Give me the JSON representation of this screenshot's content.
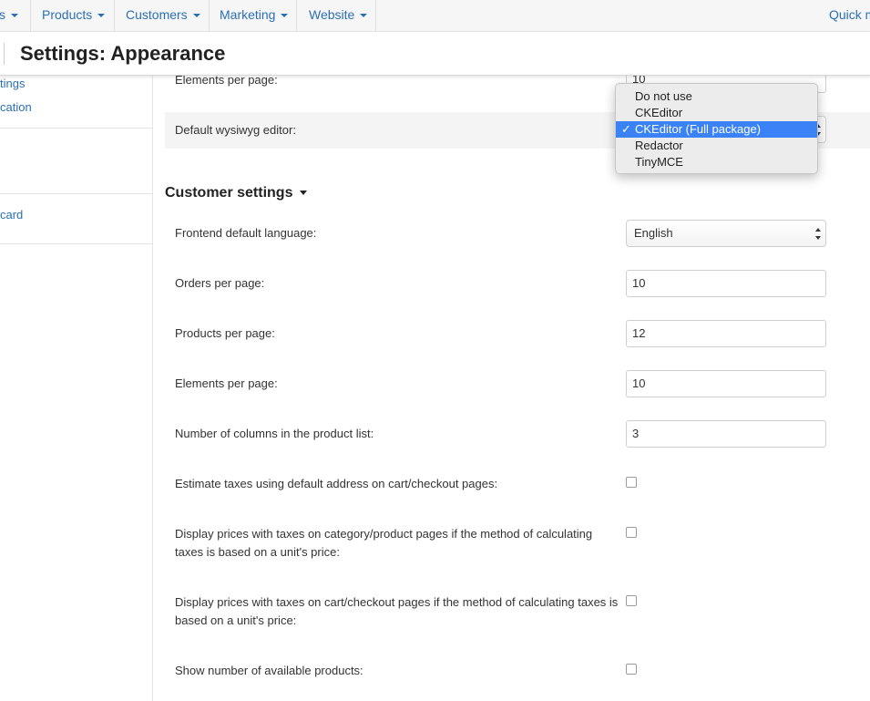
{
  "topnav": {
    "items": [
      {
        "label": "s",
        "caret": true
      },
      {
        "label": "Products",
        "caret": true
      },
      {
        "label": "Customers",
        "caret": true
      },
      {
        "label": "Marketing",
        "caret": true
      },
      {
        "label": "Website",
        "caret": true
      }
    ],
    "quick_menu": "Quick m"
  },
  "header": {
    "title": "Settings: Appearance"
  },
  "sidebar": {
    "links": [
      "tings",
      "cation",
      "card"
    ]
  },
  "appearance": {
    "elements_per_page_label": "Elements per page:",
    "elements_per_page_value": "10",
    "wysiwyg_label": "Default wysiwyg editor:",
    "wysiwyg_options": [
      "Do not use",
      "CKEditor",
      "CKEditor (Full package)",
      "Redactor",
      "TinyMCE"
    ],
    "wysiwyg_selected": "CKEditor (Full package)",
    "check_mark": "✓"
  },
  "customer_settings": {
    "title": "Customer settings",
    "frontend_language_label": "Frontend default language:",
    "frontend_language_value": "English",
    "orders_label": "Orders per page:",
    "orders_value": "10",
    "products_label": "Products per page:",
    "products_value": "12",
    "elements_label": "Elements per page:",
    "elements_value": "10",
    "columns_label": "Number of columns in the product list:",
    "columns_value": "3",
    "estimate_taxes_label": "Estimate taxes using default address on cart/checkout pages:",
    "estimate_taxes_checked": false,
    "display_prices_category_label": "Display prices with taxes on category/product pages if the method of calculating taxes is based on a unit's price:",
    "display_prices_category_checked": false,
    "display_prices_cart_label": "Display prices with taxes on cart/checkout pages if the method of calculating taxes is based on a unit's price:",
    "display_prices_cart_checked": false,
    "show_available_label": "Show number of available products:",
    "show_available_checked": false
  },
  "colors": {
    "link": "#2a6fb3",
    "selected_option": "#3b82f6"
  }
}
